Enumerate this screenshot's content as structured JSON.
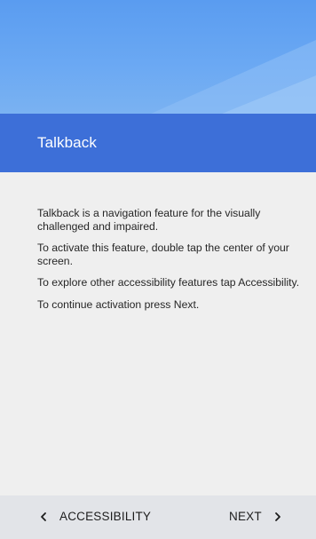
{
  "header": {
    "title": "Talkback"
  },
  "content": {
    "paragraphs": [
      "Talkback is a navigation feature for the visually challenged and impaired.",
      "To activate this feature, double tap the center of your screen.",
      "To explore other accessibility features tap Accessibility.",
      "To continue activation press Next."
    ]
  },
  "footer": {
    "back_label": "ACCESSIBILITY",
    "next_label": "NEXT",
    "back_icon": "chevron-left-icon",
    "next_icon": "chevron-right-icon"
  },
  "colors": {
    "hero": "#6aa8f3",
    "title_bar": "#3d6fd8",
    "body_background": "#efefef",
    "footer_background": "#e2e4e8"
  }
}
